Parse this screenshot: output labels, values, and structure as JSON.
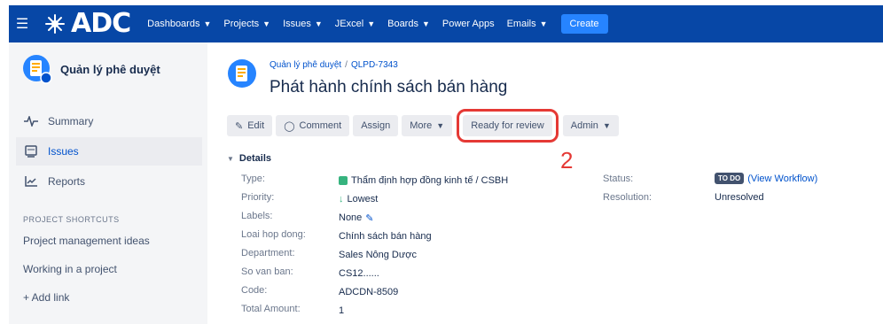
{
  "nav": {
    "logo_text": "ADC",
    "items": [
      {
        "label": "Dashboards",
        "chevron": true
      },
      {
        "label": "Projects",
        "chevron": true
      },
      {
        "label": "Issues",
        "chevron": true
      },
      {
        "label": "JExcel",
        "chevron": true
      },
      {
        "label": "Boards",
        "chevron": true
      },
      {
        "label": "Power Apps",
        "chevron": false
      },
      {
        "label": "Emails",
        "chevron": true
      }
    ],
    "create_label": "Create",
    "colors": {
      "bar": "#0747a6",
      "create": "#2684ff"
    }
  },
  "sidebar": {
    "project_name": "Quản lý phê duyệt",
    "items": [
      {
        "label": "Summary",
        "icon": "pulse-icon"
      },
      {
        "label": "Issues",
        "icon": "issues-icon",
        "active": true
      },
      {
        "label": "Reports",
        "icon": "chart-icon"
      }
    ],
    "shortcuts_heading": "PROJECT SHORTCUTS",
    "shortcuts": [
      "Project management ideas",
      "Working in a project"
    ],
    "add_link": "+  Add link"
  },
  "issue": {
    "breadcrumb_project": "Quản lý phê duyệt",
    "breadcrumb_sep": "/",
    "breadcrumb_key": "QLPD-7343",
    "title": "Phát hành chính sách bán hàng"
  },
  "toolbar": {
    "edit": "Edit",
    "comment": "Comment",
    "assign": "Assign",
    "more": "More",
    "ready": "Ready for review",
    "admin": "Admin",
    "annotation": "2",
    "highlight_color": "#e53935"
  },
  "details": {
    "heading": "Details",
    "fields": [
      {
        "label": "Type:",
        "value": "Thẩm định hợp đồng kinh tế / CSBH"
      },
      {
        "label": "Priority:",
        "value": "Lowest"
      },
      {
        "label": "Labels:",
        "value": "None"
      },
      {
        "label": "Loai hop dong:",
        "value": "Chính sách bán hàng"
      },
      {
        "label": "Department:",
        "value": "Sales Nông Dược"
      },
      {
        "label": "So van ban:",
        "value": "CS12......"
      },
      {
        "label": "Code:",
        "value": "ADCDN-8509"
      },
      {
        "label": "Total Amount:",
        "value": "1"
      }
    ],
    "right": {
      "status_label": "Status:",
      "status_lozenge": "TO DO",
      "workflow_link": "(View Workflow)",
      "resolution_label": "Resolution:",
      "resolution_value": "Unresolved"
    }
  }
}
